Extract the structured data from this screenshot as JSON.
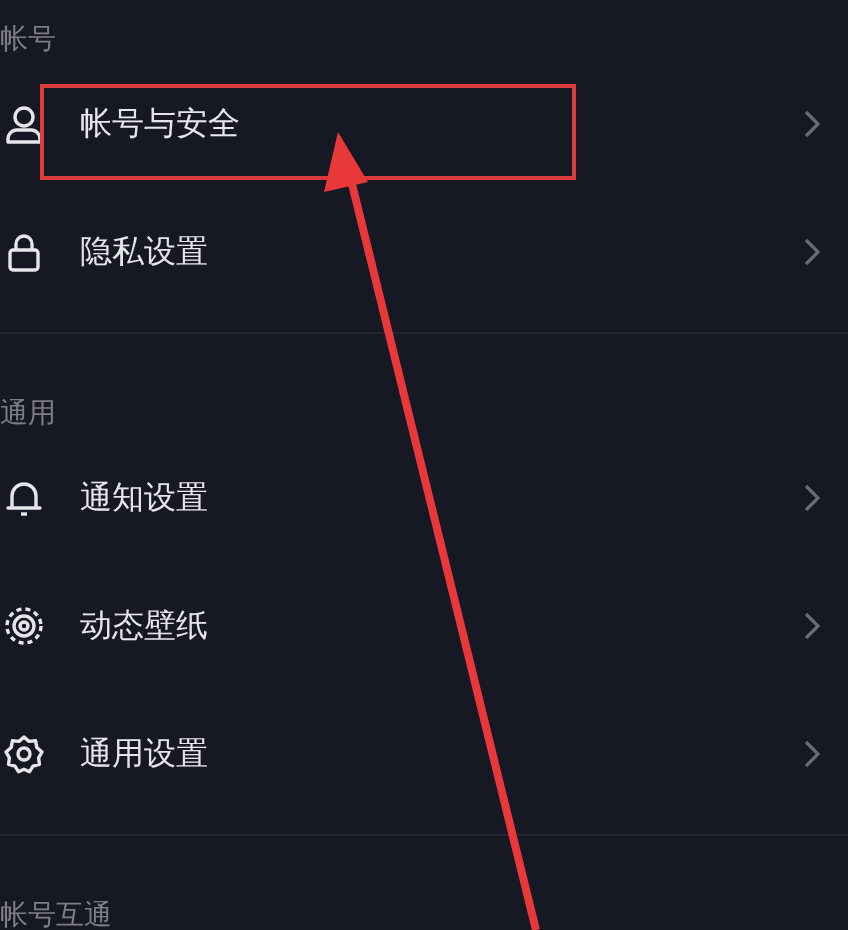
{
  "sections": [
    {
      "title": "帐号",
      "items": [
        {
          "label": "帐号与安全",
          "highlighted": true
        },
        {
          "label": "隐私设置",
          "highlighted": false
        }
      ]
    },
    {
      "title": "通用",
      "items": [
        {
          "label": "通知设置",
          "highlighted": false
        },
        {
          "label": "动态壁纸",
          "highlighted": false
        },
        {
          "label": "通用设置",
          "highlighted": false
        }
      ]
    },
    {
      "title": "帐号互通"
    }
  ]
}
